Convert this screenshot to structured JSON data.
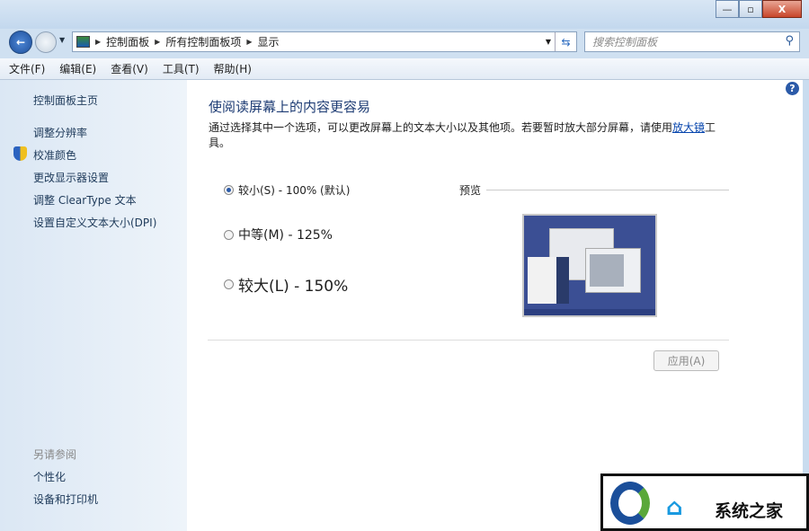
{
  "window": {
    "controls": {
      "minimize": "—",
      "maximize": "▫",
      "close": "X"
    }
  },
  "nav": {
    "breadcrumbs": [
      "控制面板",
      "所有控制面板项",
      "显示"
    ],
    "search_placeholder": "搜索控制面板"
  },
  "menu": [
    "文件(F)",
    "编辑(E)",
    "查看(V)",
    "工具(T)",
    "帮助(H)"
  ],
  "sidebar": {
    "home": "控制面板主页",
    "items": [
      "调整分辨率",
      "校准颜色",
      "更改显示器设置",
      "调整 ClearType 文本",
      "设置自定义文本大小(DPI)"
    ],
    "see_also": "另请参阅",
    "see_also_items": [
      "个性化",
      "设备和打印机"
    ]
  },
  "main": {
    "title": "使阅读屏幕上的内容更容易",
    "desc_pre": "通过选择其中一个选项，可以更改屏幕上的文本大小以及其他项。若要暂时放大部分屏幕，请使用",
    "desc_link": "放大镜",
    "desc_post": "工具。",
    "options": [
      {
        "label": "较小(S) - 100% (默认)",
        "selected": true
      },
      {
        "label": "中等(M) - 125%",
        "selected": false
      },
      {
        "label": "较大(L) - 150%",
        "selected": false
      }
    ],
    "preview_label": "预览",
    "apply": "应用(A)",
    "help": "?"
  },
  "watermark": {
    "text": "系统之家"
  },
  "colors": {
    "link": "#0645ad",
    "title": "#1e3c74",
    "sidebar": "#dbe7f4"
  }
}
